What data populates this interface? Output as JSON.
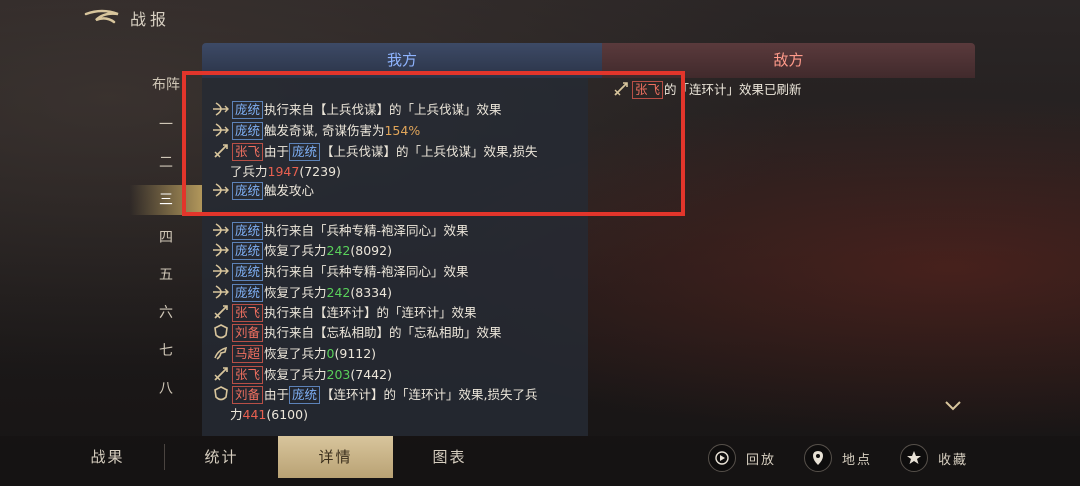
{
  "header": {
    "title": "战报"
  },
  "side_nav": {
    "items": [
      {
        "label": "布阵"
      },
      {
        "label": "一"
      },
      {
        "label": "二"
      },
      {
        "label": "三"
      },
      {
        "label": "四"
      },
      {
        "label": "五"
      },
      {
        "label": "六"
      },
      {
        "label": "七"
      },
      {
        "label": "八"
      }
    ],
    "active_index": 3
  },
  "tabs": {
    "ours": "我方",
    "enemy": "敌方"
  },
  "our_log": [
    {
      "icon": "bow-icon",
      "parts": [
        {
          "t": "name",
          "c": "blue",
          "v": "庞统"
        },
        {
          "t": "text",
          "v": "执行来自【上兵伐谋】的「上兵伐谋」效果"
        }
      ]
    },
    {
      "icon": "bow-icon",
      "parts": [
        {
          "t": "name",
          "c": "blue",
          "v": "庞统"
        },
        {
          "t": "text",
          "v": "触发奇谋, 奇谋伤害为"
        },
        {
          "t": "pct",
          "v": "154%"
        }
      ]
    },
    {
      "icon": "spear-icon",
      "parts": [
        {
          "t": "name",
          "c": "red",
          "v": "张飞"
        },
        {
          "t": "text",
          "v": "由于"
        },
        {
          "t": "name",
          "c": "blue",
          "v": "庞统"
        },
        {
          "t": "text",
          "v": "【上兵伐谋】的「上兵伐谋」效果,损失"
        }
      ],
      "cont": [
        {
          "t": "text",
          "v": "了兵力"
        },
        {
          "t": "loss",
          "v": "1947"
        },
        {
          "t": "text",
          "v": "(7239)"
        }
      ]
    },
    {
      "icon": "bow-icon",
      "parts": [
        {
          "t": "name",
          "c": "blue",
          "v": "庞统"
        },
        {
          "t": "text",
          "v": "触发攻心"
        }
      ]
    },
    {
      "icon": "bow-icon",
      "parts": [
        {
          "t": "name",
          "c": "blue",
          "v": "庞统"
        },
        {
          "t": "text",
          "v": "执行来自「兵种专精-袍泽同心」效果"
        }
      ]
    },
    {
      "icon": "bow-icon",
      "parts": [
        {
          "t": "name",
          "c": "blue",
          "v": "庞统"
        },
        {
          "t": "text",
          "v": "恢复了兵力"
        },
        {
          "t": "gain",
          "v": "242"
        },
        {
          "t": "text",
          "v": "(8092)"
        }
      ]
    },
    {
      "icon": "bow-icon",
      "parts": [
        {
          "t": "name",
          "c": "blue",
          "v": "庞统"
        },
        {
          "t": "text",
          "v": "执行来自「兵种专精-袍泽同心」效果"
        }
      ]
    },
    {
      "icon": "bow-icon",
      "parts": [
        {
          "t": "name",
          "c": "blue",
          "v": "庞统"
        },
        {
          "t": "text",
          "v": "恢复了兵力"
        },
        {
          "t": "gain",
          "v": "242"
        },
        {
          "t": "text",
          "v": "(8334)"
        }
      ]
    },
    {
      "icon": "spear-icon",
      "parts": [
        {
          "t": "name",
          "c": "red",
          "v": "张飞"
        },
        {
          "t": "text",
          "v": "执行来自【连环计】的「连环计」效果"
        }
      ]
    },
    {
      "icon": "shield-icon",
      "parts": [
        {
          "t": "name",
          "c": "red",
          "v": "刘备"
        },
        {
          "t": "text",
          "v": "执行来自【忘私相助】的「忘私相助」效果"
        }
      ]
    },
    {
      "icon": "horse-icon",
      "parts": [
        {
          "t": "name",
          "c": "red",
          "v": "马超"
        },
        {
          "t": "text",
          "v": "恢复了兵力"
        },
        {
          "t": "gain",
          "v": "0"
        },
        {
          "t": "text",
          "v": "(9112)"
        }
      ]
    },
    {
      "icon": "spear-icon",
      "parts": [
        {
          "t": "name",
          "c": "red",
          "v": "张飞"
        },
        {
          "t": "text",
          "v": "恢复了兵力"
        },
        {
          "t": "gain",
          "v": "203"
        },
        {
          "t": "text",
          "v": "(7442)"
        }
      ]
    },
    {
      "icon": "shield-icon",
      "parts": [
        {
          "t": "name",
          "c": "red",
          "v": "刘备"
        },
        {
          "t": "text",
          "v": "由于"
        },
        {
          "t": "name",
          "c": "blue",
          "v": "庞统"
        },
        {
          "t": "text",
          "v": "【连环计】的「连环计」效果,损失了兵"
        }
      ],
      "cont": [
        {
          "t": "text",
          "v": "力"
        },
        {
          "t": "loss",
          "v": "441"
        },
        {
          "t": "text",
          "v": "(6100)"
        }
      ]
    }
  ],
  "enemy_log": [
    {
      "icon": "spear-icon",
      "parts": [
        {
          "t": "name",
          "c": "red",
          "v": "张飞"
        },
        {
          "t": "text",
          "v": "的「连环计」效果已刷新"
        }
      ]
    }
  ],
  "bottom_tabs": [
    {
      "label": "战果"
    },
    {
      "label": "统计"
    },
    {
      "label": "详情"
    },
    {
      "label": "图表"
    }
  ],
  "bottom_active": 2,
  "actions": [
    {
      "label": "回放",
      "icon": "replay-icon"
    },
    {
      "label": "地点",
      "icon": "location-pin-icon"
    },
    {
      "label": "收藏",
      "icon": "star-icon"
    }
  ],
  "colors": {
    "accent_gold": "#c9b27f",
    "highlight_red": "#e2352b",
    "our_blue": "#7fb0f5",
    "enemy_red": "#f07060"
  }
}
